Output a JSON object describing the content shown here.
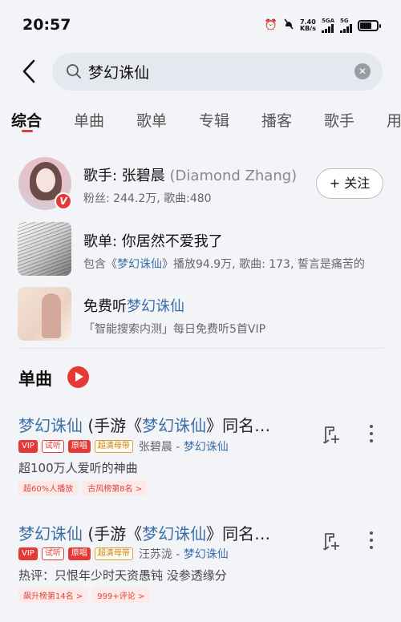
{
  "status": {
    "time": "20:57",
    "net_speed_value": "7.40",
    "net_speed_unit": "KB/s",
    "sim1_label": "5GA",
    "sim2_label": "5G"
  },
  "search": {
    "query": "梦幻诛仙"
  },
  "tabs": [
    {
      "label": "综合"
    },
    {
      "label": "单曲"
    },
    {
      "label": "歌单"
    },
    {
      "label": "专辑"
    },
    {
      "label": "播客"
    },
    {
      "label": "歌手"
    },
    {
      "label": "用"
    }
  ],
  "artist": {
    "prefix": "歌手: 张碧晨",
    "en_name": "(Diamond Zhang)",
    "sub": "粉丝: 244.2万, 歌曲:480",
    "badge": "V",
    "follow_label": "+ 关注"
  },
  "playlist": {
    "title": "歌单: 你居然不爱我了",
    "sub_prefix": "包含《",
    "sub_keyword": "梦幻诛仙",
    "sub_suffix": "》播放94.9万, 歌曲: 173, 誓言是痛苦的"
  },
  "free_listen": {
    "title_prefix": "免费听",
    "title_keyword": "梦幻诛仙",
    "sub": "「智能搜索内测」每日免费听5首VIP"
  },
  "section": {
    "title": "单曲"
  },
  "songs": [
    {
      "title_kw1": "梦幻诛仙",
      "title_mid": " (手游《",
      "title_kw2": "梦幻诛仙",
      "title_end": "》同名…",
      "tags": [
        "VIP",
        "试听",
        "原唱",
        "超清母带"
      ],
      "artist": "张碧晨",
      "sep": " - ",
      "album": "梦幻诛仙",
      "desc": "超100万人爱听的神曲",
      "pills": [
        "超60%人播放",
        "古风榜第8名 >"
      ]
    },
    {
      "title_kw1": "梦幻诛仙",
      "title_mid": " (手游《",
      "title_kw2": "梦幻诛仙",
      "title_end": "》同名…",
      "tags": [
        "VIP",
        "试听",
        "原唱",
        "超清母带"
      ],
      "artist": "汪苏泷",
      "sep": " - ",
      "album": "梦幻诛仙",
      "desc": "热评：只恨年少时天资愚钝 没参透缘分",
      "pills": [
        "飙升榜第14名 >",
        "999+评论 >"
      ]
    }
  ]
}
